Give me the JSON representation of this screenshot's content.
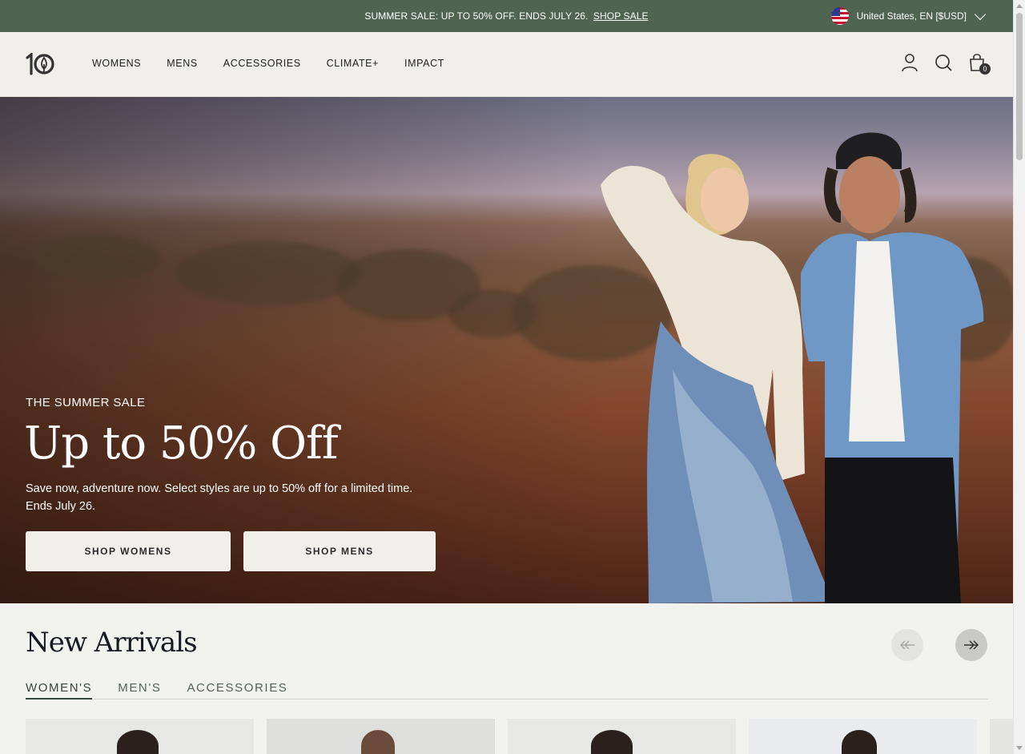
{
  "announcement": {
    "text": "SUMMER SALE: UP TO 50% OFF. ENDS JULY 26.",
    "link": "SHOP SALE",
    "locale": "United States, EN [$USD]"
  },
  "header": {
    "logo_alt": "tentree",
    "nav": [
      "WOMENS",
      "MENS",
      "ACCESSORIES",
      "CLIMATE+",
      "IMPACT"
    ],
    "cart_count": "0"
  },
  "hero": {
    "kicker": "THE SUMMER SALE",
    "title": "Up to 50% Off",
    "description": "Save now, adventure now. Select styles are up to 50% off for a limited time. Ends July 26.",
    "buttons": [
      "SHOP WOMENS",
      "SHOP MENS"
    ]
  },
  "new_arrivals": {
    "title": "New Arrivals",
    "tabs": [
      "WOMEN'S",
      "MEN'S",
      "ACCESSORIES"
    ],
    "active_tab": "WOMEN'S"
  },
  "colors": {
    "announcement_bg": "#4f6552",
    "header_bg": "#f0efea",
    "page_bg": "#f2f2ee",
    "tab_active": "#37453e"
  }
}
